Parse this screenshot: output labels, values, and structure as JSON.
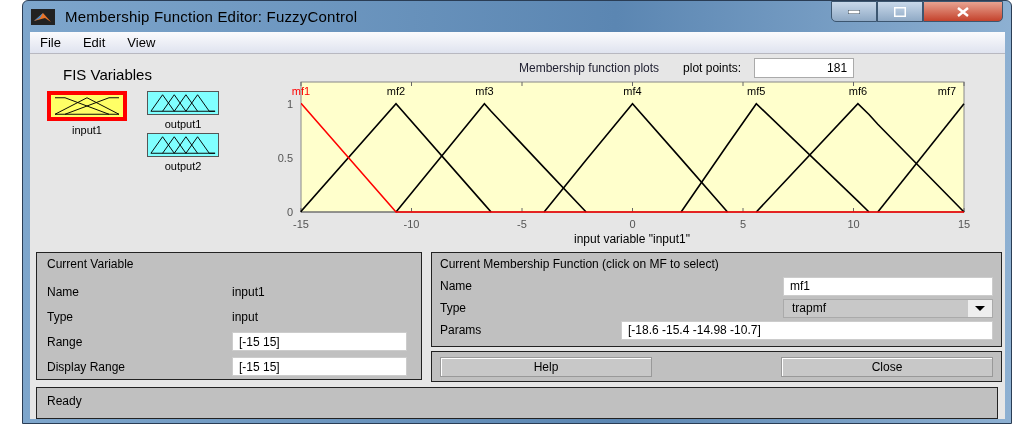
{
  "window": {
    "title": "Membership Function Editor: FuzzyControl"
  },
  "menu": [
    "File",
    "Edit",
    "View"
  ],
  "fis_variables": {
    "title": "FIS Variables",
    "items": [
      {
        "label": "input1",
        "kind": "input",
        "selected": true,
        "color": "#ffff66"
      },
      {
        "label": "output1",
        "kind": "output",
        "selected": false,
        "color": "#80ffff"
      },
      {
        "label": "output2",
        "kind": "output",
        "selected": false,
        "color": "#80ffff"
      }
    ]
  },
  "plot_panel": {
    "plot_points_label": "plot points:",
    "plot_points": "181",
    "chart_data": {
      "type": "line",
      "title": "Membership function plots",
      "xlabel": "input variable \"input1\"",
      "x": [
        -15,
        -14.98,
        -10.7,
        -6.7,
        -6.4,
        -4,
        -2.1,
        0,
        2.2,
        4.3,
        5.6,
        10.2,
        10.7,
        11.1,
        15
      ],
      "xlim": [
        -15,
        15
      ],
      "ylim": [
        0,
        1.2
      ],
      "xticks": [
        -15,
        -10,
        -5,
        0,
        5,
        10,
        15
      ],
      "yticks": [
        0,
        0.5,
        1
      ],
      "series": [
        {
          "name": "mf1",
          "color": "#ff0000",
          "values": [
            1,
            1,
            0,
            0,
            0,
            0,
            0,
            0,
            0,
            0,
            0,
            0,
            0,
            0,
            0
          ]
        },
        {
          "name": "mf2",
          "color": "#000000",
          "values": [
            0,
            0.01,
            1,
            0.07,
            0,
            null,
            null,
            null,
            null,
            null,
            null,
            null,
            null,
            null,
            null
          ]
        },
        {
          "name": "mf3",
          "color": "#000000",
          "values": [
            null,
            null,
            0,
            1,
            0.93,
            0.41,
            0,
            null,
            null,
            null,
            null,
            null,
            null,
            null,
            null
          ]
        },
        {
          "name": "mf4",
          "color": "#000000",
          "values": [
            null,
            null,
            null,
            null,
            null,
            0,
            0.48,
            1,
            0.49,
            0,
            null,
            null,
            null,
            null,
            null
          ]
        },
        {
          "name": "mf5",
          "color": "#000000",
          "values": [
            null,
            null,
            null,
            null,
            null,
            null,
            null,
            null,
            0,
            0.62,
            1,
            0.1,
            0,
            null,
            null
          ]
        },
        {
          "name": "mf6",
          "color": "#000000",
          "values": [
            null,
            null,
            null,
            null,
            null,
            null,
            null,
            null,
            null,
            null,
            0,
            1,
            0.9,
            0.81,
            0
          ]
        },
        {
          "name": "mf7",
          "color": "#000000",
          "values": [
            null,
            null,
            null,
            null,
            null,
            null,
            null,
            null,
            null,
            null,
            null,
            null,
            null,
            0,
            1
          ]
        }
      ]
    }
  },
  "current_variable": {
    "title": "Current Variable",
    "rows": [
      {
        "label": "Name",
        "value": "input1",
        "kind": "text"
      },
      {
        "label": "Type",
        "value": "input",
        "kind": "text"
      },
      {
        "label": "Range",
        "value": "[-15 15]",
        "kind": "field"
      },
      {
        "label": "Display Range",
        "value": "[-15 15]",
        "kind": "field"
      }
    ]
  },
  "current_mf": {
    "title": "Current Membership Function (click on MF to select)",
    "rows": [
      {
        "label": "Name",
        "value": "mf1",
        "kind": "field"
      },
      {
        "label": "Type",
        "value": "trapmf",
        "kind": "dropdown"
      },
      {
        "label": "Params",
        "value": "[-18.6 -15.4 -14.98 -10.7]",
        "kind": "wide"
      }
    ]
  },
  "buttons": [
    "Help",
    "Close"
  ],
  "status_bar": "Ready"
}
